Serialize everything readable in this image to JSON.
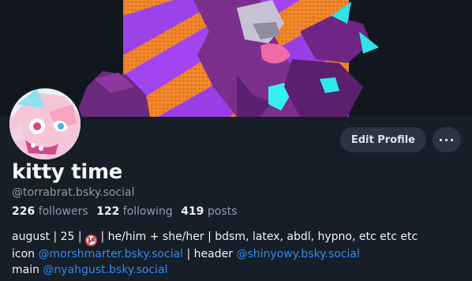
{
  "profile": {
    "display_name": "kitty time",
    "handle": "@torrabrat.bsky.social",
    "stats": {
      "followers_count": "226",
      "followers_label": "followers",
      "following_count": "122",
      "following_label": "following",
      "posts_count": "419",
      "posts_label": "posts"
    },
    "bio": {
      "line1_before_badge": "august | 25 | ",
      "badge_icon": "no-under-18-icon",
      "line1_after_badge": " | he/him + she/her | bdsm, latex, abdl, hypno, etc etc etc",
      "line2_prefix": "icon ",
      "line2_link1": "@morshmarter.bsky.social",
      "line2_mid": " | header ",
      "line2_link2": "@shinyowy.bsky.social",
      "line3_prefix": "main ",
      "line3_link": "@nyahgust.bsky.social"
    }
  },
  "actions": {
    "edit_profile_label": "Edit Profile",
    "more_label": "···",
    "more_icon": "ellipsis-icon"
  },
  "colors": {
    "background": "#161e27",
    "link": "#2f8cf4",
    "muted": "#8c9aab",
    "button_bg": "#2a3543"
  }
}
